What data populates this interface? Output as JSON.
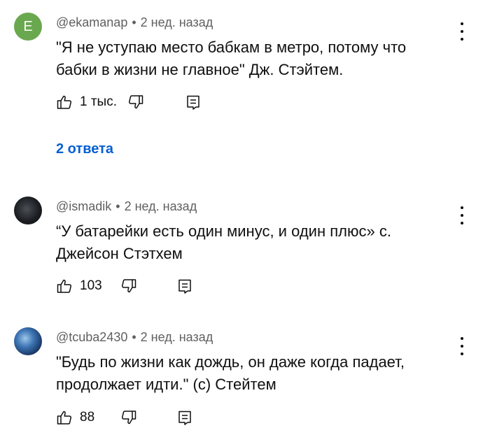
{
  "comments": [
    {
      "avatar_letter": "E",
      "avatar_color": "#6aa84f",
      "author": "@ekamanap",
      "time": "2 нед. назад",
      "text_lines": [
        "\"Я не уступаю место бабкам в метро, потому что",
        "бабки в жизни не главное\" Дж. Стэйтем."
      ],
      "likes": "1 тыс.",
      "replies_label": "2 ответа"
    },
    {
      "author": "@ismadik",
      "time": "2 нед. назад",
      "text_lines": [
        "“У батарейки есть один минус, и один плюс» с.",
        "Джейсон Стэтхем"
      ],
      "likes": "103"
    },
    {
      "author": "@tcuba2430",
      "time": "2 нед. назад",
      "text_lines": [
        "\"Будь по жизни как дождь, он даже когда падает,",
        "продолжает идти.\"  (с) Стейтем"
      ],
      "likes": "88"
    }
  ],
  "separator": "•",
  "icons": [
    "like-icon",
    "dislike-icon",
    "reply-icon",
    "more-vert-icon"
  ],
  "colors": {
    "link": "#065fd4",
    "meta": "#606060",
    "text": "#0f0f0f"
  }
}
